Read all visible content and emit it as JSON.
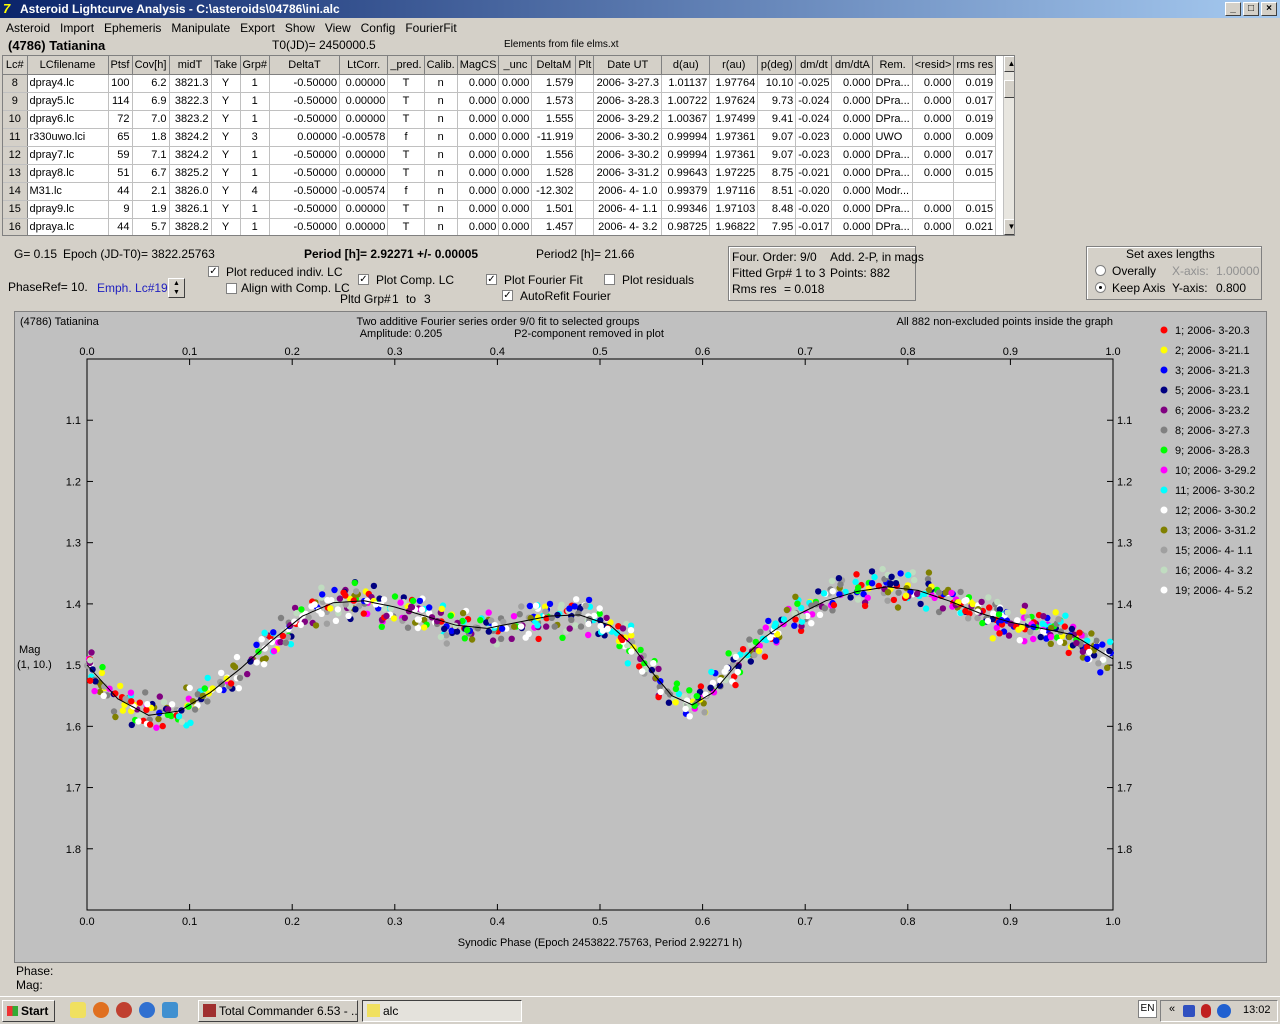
{
  "window": {
    "title": "Asteroid Lightcurve Analysis - C:\\asteroids\\04786\\ini.alc",
    "icon": "alc-app-icon",
    "buttons": [
      "_",
      "□",
      "×"
    ]
  },
  "menu": [
    "Asteroid",
    "Import",
    "Ephemeris",
    "Manipulate",
    "Export",
    "Show",
    "View",
    "Config",
    "FourierFit"
  ],
  "object": {
    "name": "(4786) Tatianina",
    "t0": "T0(JD)= 2450000.5",
    "elements": "Elements from file elms.xt"
  },
  "table": {
    "columns": [
      "Lc#",
      "LCfilename",
      "Ptsf",
      "Cov[h]",
      "midT",
      "Take",
      "Grp#",
      "DeltaT",
      "LtCorr.",
      "_pred.",
      "Calib.",
      "MagCS",
      "_unc",
      "DeltaM",
      "Plt",
      "Date UT",
      "d(au)",
      "r(au)",
      "p(deg)",
      "dm/dt",
      "dm/dtA",
      "Rem.",
      "<resid>",
      "rms res"
    ],
    "rows": [
      [
        "8",
        "dpray4.lc",
        "100",
        "6.2",
        "3821.3",
        "Y",
        "1",
        "-0.50000",
        "0.00000",
        "T",
        "n",
        "0.000",
        "0.000",
        "1.579",
        "",
        "2006- 3-27.3",
        "1.01137",
        "1.97764",
        "10.10",
        "-0.025",
        "0.000",
        "DPra...",
        "0.000",
        "0.019"
      ],
      [
        "9",
        "dpray5.lc",
        "114",
        "6.9",
        "3822.3",
        "Y",
        "1",
        "-0.50000",
        "0.00000",
        "T",
        "n",
        "0.000",
        "0.000",
        "1.573",
        "",
        "2006- 3-28.3",
        "1.00722",
        "1.97624",
        "9.73",
        "-0.024",
        "0.000",
        "DPra...",
        "0.000",
        "0.017"
      ],
      [
        "10",
        "dpray6.lc",
        "72",
        "7.0",
        "3823.2",
        "Y",
        "1",
        "-0.50000",
        "0.00000",
        "T",
        "n",
        "0.000",
        "0.000",
        "1.555",
        "",
        "2006- 3-29.2",
        "1.00367",
        "1.97499",
        "9.41",
        "-0.024",
        "0.000",
        "DPra...",
        "0.000",
        "0.019"
      ],
      [
        "11",
        "r330uwo.lci",
        "65",
        "1.8",
        "3824.2",
        "Y",
        "3",
        "0.00000",
        "-0.00578",
        "f",
        "n",
        "0.000",
        "0.000",
        "-11.919",
        "",
        "2006- 3-30.2",
        "0.99994",
        "1.97361",
        "9.07",
        "-0.023",
        "0.000",
        "UWO",
        "0.000",
        "0.009"
      ],
      [
        "12",
        "dpray7.lc",
        "59",
        "7.1",
        "3824.2",
        "Y",
        "1",
        "-0.50000",
        "0.00000",
        "T",
        "n",
        "0.000",
        "0.000",
        "1.556",
        "",
        "2006- 3-30.2",
        "0.99994",
        "1.97361",
        "9.07",
        "-0.023",
        "0.000",
        "DPra...",
        "0.000",
        "0.017"
      ],
      [
        "13",
        "dpray8.lc",
        "51",
        "6.7",
        "3825.2",
        "Y",
        "1",
        "-0.50000",
        "0.00000",
        "T",
        "n",
        "0.000",
        "0.000",
        "1.528",
        "",
        "2006- 3-31.2",
        "0.99643",
        "1.97225",
        "8.75",
        "-0.021",
        "0.000",
        "DPra...",
        "0.000",
        "0.015"
      ],
      [
        "14",
        "M31.lc",
        "44",
        "2.1",
        "3826.0",
        "Y",
        "4",
        "-0.50000",
        "-0.00574",
        "f",
        "n",
        "0.000",
        "0.000",
        "-12.302",
        "",
        "2006- 4- 1.0",
        "0.99379",
        "1.97116",
        "8.51",
        "-0.020",
        "0.000",
        "Modr...",
        "",
        ""
      ],
      [
        "15",
        "dpray9.lc",
        "9",
        "1.9",
        "3826.1",
        "Y",
        "1",
        "-0.50000",
        "0.00000",
        "T",
        "n",
        "0.000",
        "0.000",
        "1.501",
        "",
        "2006- 4- 1.1",
        "0.99346",
        "1.97103",
        "8.48",
        "-0.020",
        "0.000",
        "DPra...",
        "0.000",
        "0.015"
      ],
      [
        "16",
        "dpraya.lc",
        "44",
        "5.7",
        "3828.2",
        "Y",
        "1",
        "-0.50000",
        "0.00000",
        "T",
        "n",
        "0.000",
        "0.000",
        "1.457",
        "",
        "2006- 4- 3.2",
        "0.98725",
        "1.96822",
        "7.95",
        "-0.017",
        "0.000",
        "DPra...",
        "0.000",
        "0.021"
      ]
    ]
  },
  "params": {
    "g": "G= 0.15",
    "epoch": "Epoch (JD-T0)= 3822.25763",
    "period": "Period [h]= 2.92271 +/- 0.00005",
    "period2": "Period2 [h]= 21.66",
    "phaseref": "PhaseRef= 10.",
    "emph": "Emph. Lc#19:"
  },
  "checks": {
    "reduced": {
      "label": "Plot reduced indiv. LC",
      "checked": true
    },
    "align": {
      "label": "Align with Comp. LC",
      "checked": false
    },
    "comp": {
      "label": "Plot Comp. LC",
      "checked": true
    },
    "fourier": {
      "label": "Plot Fourier Fit",
      "checked": true
    },
    "residuals": {
      "label": "Plot residuals",
      "checked": false
    },
    "autorefit": {
      "label": "AutoRefit Fourier",
      "checked": true
    },
    "pltd": "Pltd Grp#",
    "pltd_from": "1",
    "pltd_to_lbl": "to",
    "pltd_to": "3"
  },
  "fourier_info": {
    "order": "Four. Order:  9/0",
    "add": "Add. 2-P, in mags",
    "fitted": "Fitted Grp# 1 to 3",
    "points": "Points: 882",
    "rms_lbl": "Rms res",
    "rms_val": "= 0.018"
  },
  "axes_box": {
    "title": "Set axes lengths",
    "overally": "Overally",
    "keep": "Keep Axis",
    "xaxis_lbl": "X-axis:",
    "xaxis_val": "1.00000",
    "yaxis_lbl": "Y-axis:",
    "yaxis_val": "0.800",
    "selected": "keep"
  },
  "plot_header": {
    "object": "(4786) Tatianina",
    "line1": "Two additive Fourier series order 9/0 fit to selected groups",
    "amplitude": "Amplitude: 0.205",
    "p2": "P2-component removed in plot",
    "inside": "All 882 non-excluded points inside the graph",
    "ylabel1": "Mag",
    "ylabel2": "(1, 10.)"
  },
  "chart_data": {
    "type": "scatter",
    "xlabel": "Synodic Phase (Epoch 2453822.75763, Period 2.92271 h)",
    "ylabel": "Mag (1, 10.)",
    "xlim": [
      0.0,
      1.0
    ],
    "ylim": [
      1.0,
      1.9
    ],
    "y_inverted": true,
    "xticks": [
      "0.0",
      "0.1",
      "0.2",
      "0.3",
      "0.4",
      "0.5",
      "0.6",
      "0.7",
      "0.8",
      "0.9",
      "1.0"
    ],
    "yticks": [
      "1.1",
      "1.2",
      "1.3",
      "1.4",
      "1.5",
      "1.6",
      "1.7",
      "1.8"
    ],
    "grid": false,
    "legend_position": "right",
    "fit_curve": {
      "x": [
        0.0,
        0.03,
        0.06,
        0.09,
        0.12,
        0.15,
        0.18,
        0.21,
        0.24,
        0.27,
        0.3,
        0.33,
        0.36,
        0.39,
        0.42,
        0.45,
        0.48,
        0.51,
        0.53,
        0.55,
        0.57,
        0.59,
        0.61,
        0.63,
        0.66,
        0.69,
        0.72,
        0.75,
        0.78,
        0.81,
        0.84,
        0.87,
        0.9,
        0.93,
        0.96,
        1.0
      ],
      "y": [
        1.5,
        1.555,
        1.582,
        1.575,
        1.545,
        1.505,
        1.46,
        1.42,
        1.398,
        1.395,
        1.405,
        1.42,
        1.435,
        1.44,
        1.43,
        1.42,
        1.418,
        1.435,
        1.465,
        1.51,
        1.55,
        1.565,
        1.545,
        1.505,
        1.455,
        1.42,
        1.395,
        1.38,
        1.372,
        1.378,
        1.395,
        1.415,
        1.43,
        1.44,
        1.45,
        1.49
      ]
    },
    "series": [
      {
        "name": "1; 2006- 3-20.3",
        "color": "#ff0000"
      },
      {
        "name": "2; 2006- 3-21.1",
        "color": "#ffff00"
      },
      {
        "name": "3; 2006- 3-21.3",
        "color": "#0000ff"
      },
      {
        "name": "5; 2006- 3-23.1",
        "color": "#000080"
      },
      {
        "name": "6; 2006- 3-23.2",
        "color": "#800080"
      },
      {
        "name": "8; 2006- 3-27.3",
        "color": "#808080"
      },
      {
        "name": "9; 2006- 3-28.3",
        "color": "#00ff00"
      },
      {
        "name": "10; 2006- 3-29.2",
        "color": "#ff00ff"
      },
      {
        "name": "11; 2006- 3-30.2",
        "color": "#00ffff"
      },
      {
        "name": "12; 2006- 3-30.2",
        "color": "#ffffff"
      },
      {
        "name": "13; 2006- 3-31.2",
        "color": "#808000"
      },
      {
        "name": "15; 2006- 4- 1.1",
        "color": "#a0a0a0"
      },
      {
        "name": "16; 2006- 4- 3.2",
        "color": "#c0dcc0"
      },
      {
        "name": "19; 2006- 4- 5.2",
        "color": "#ffffff"
      }
    ],
    "points_count": 882
  },
  "readout": {
    "phase": "Phase:",
    "mag": "Mag:"
  },
  "taskbar": {
    "start": "Start",
    "tasks": [
      "Total Commander 6.53 - ...",
      "alc"
    ],
    "lang": "EN",
    "clock": "13:02"
  }
}
